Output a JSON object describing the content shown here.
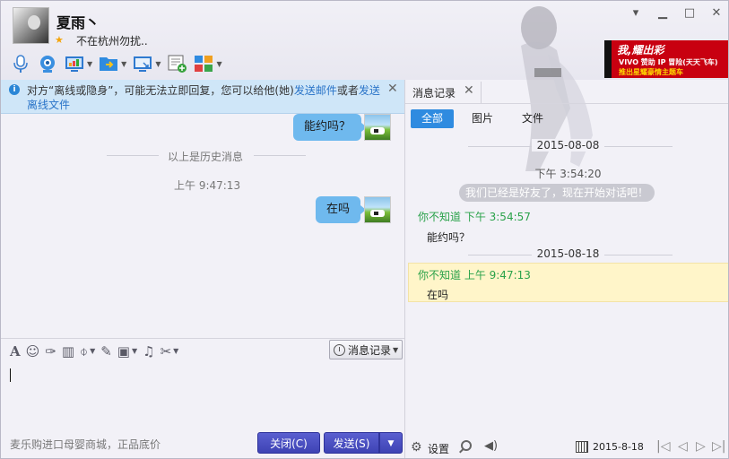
{
  "window": {
    "contact_name": "夏雨丶",
    "signature": "不在杭州勿扰..",
    "controls": {
      "menu": "▾",
      "minimize": "▁",
      "maximize": "□",
      "close": "✕"
    }
  },
  "ad_banner": {
    "line1": "我,耀出彩",
    "line2": "VIVO 赞助 IP 冒险(天天飞车)",
    "line3": "推出星耀豪情主题车"
  },
  "notice": {
    "text_prefix": "对方“离线或隐身”，可能无法立即回复，您可以给他(她)",
    "link_email": "发送邮件",
    "or": "或者",
    "link_send": "发送",
    "link_offline": "离线文件",
    "close": "✕"
  },
  "chat": {
    "messages_top": [
      {
        "text": "能约吗？"
      }
    ],
    "history_divider": "以上是历史消息",
    "time": "上午 9:47:13",
    "messages_bottom": [
      {
        "text": "在吗"
      }
    ]
  },
  "input": {
    "history_button": "消息记录",
    "bottom_ad": "麦乐购进口母婴商城，正品底价",
    "close_button": "关闭(C)",
    "send_button": "发送(S)",
    "send_dropdown": "▼"
  },
  "history": {
    "tab_label": "消息记录",
    "tab_close": "✕",
    "filters": {
      "all": "全部",
      "images": "图片",
      "files": "文件"
    },
    "records": [
      {
        "date": "2015-08-08"
      },
      {
        "system_time": "下午 3:54:20",
        "system_msg": "我们已经是好友了，现在开始对话吧！"
      },
      {
        "sender": "你不知道 下午 3:54:57",
        "text": "能约吗？"
      },
      {
        "date": "2015-08-18"
      },
      {
        "sender": "你不知道 上午 9:47:13",
        "text": "在吗"
      }
    ],
    "bottom": {
      "settings_label": "设置",
      "current_date": "2015-8-18",
      "nav_first": "|◁",
      "nav_prev": "◁",
      "nav_next": "▷",
      "nav_last": "▷|"
    }
  },
  "colors": {
    "bubble": "#6fb9ee",
    "accent_button": "#3e43b4",
    "filter_active": "#2f8be0",
    "sender_green": "#2aa24a",
    "highlight": "#fff5c9",
    "notice_bg": "#cfe6f8"
  },
  "icons": [
    "microphone-icon",
    "webcam-icon",
    "share-screen-icon",
    "send-file-icon",
    "remote-desktop-icon",
    "app-add-icon",
    "apps-grid-icon",
    "font-icon",
    "emoji-icon",
    "magic-icon",
    "screenshot-icon",
    "voice-icon",
    "edit-icon",
    "image-icon",
    "music-icon",
    "scissors-icon",
    "clock-icon",
    "gear-icon",
    "search-icon",
    "speaker-icon",
    "calendar-icon"
  ]
}
